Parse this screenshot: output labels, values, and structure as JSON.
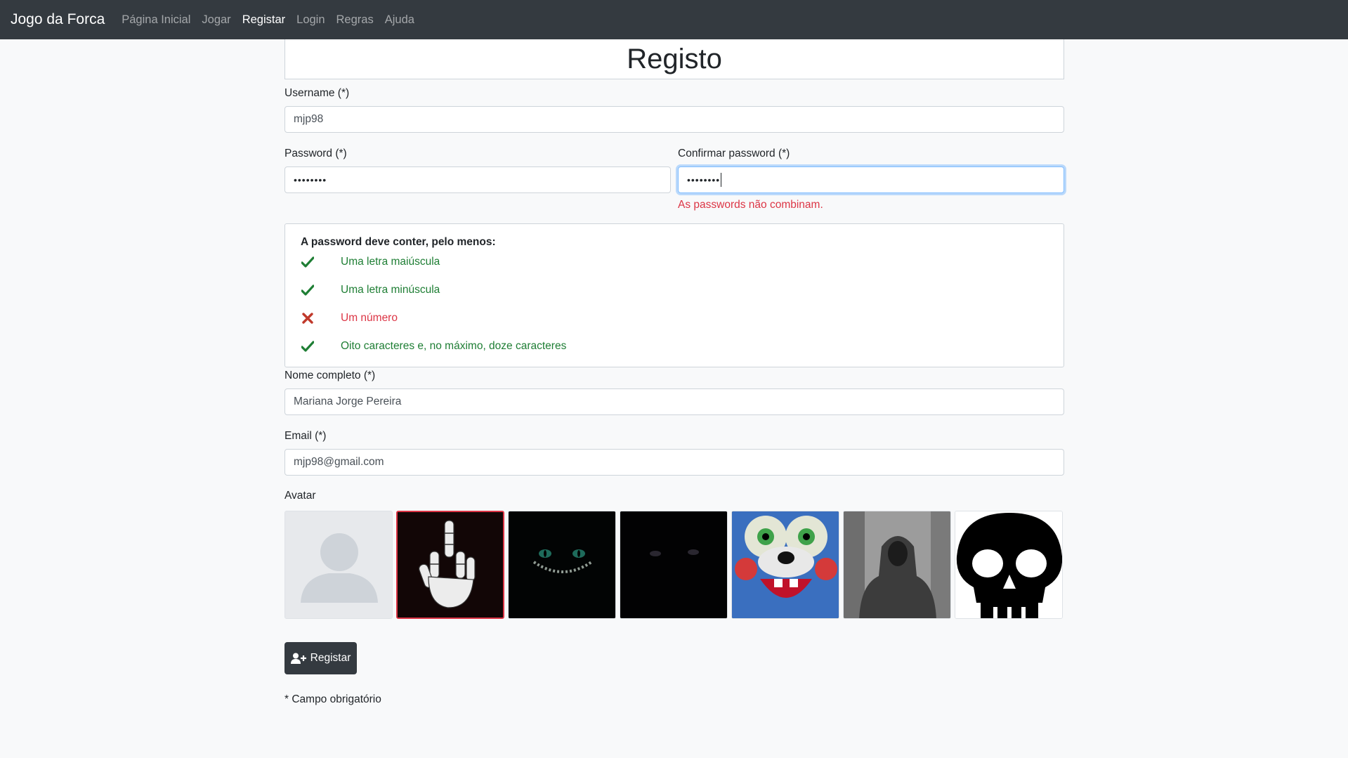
{
  "nav": {
    "brand": "Jogo da Forca",
    "items": [
      {
        "label": "Página Inicial",
        "active": false
      },
      {
        "label": "Jogar",
        "active": false
      },
      {
        "label": "Registar",
        "active": true
      },
      {
        "label": "Login",
        "active": false
      },
      {
        "label": "Regras",
        "active": false
      },
      {
        "label": "Ajuda",
        "active": false
      }
    ]
  },
  "page_title": "Registo",
  "form": {
    "username_label": "Username (*)",
    "username_value": "mjp98",
    "password_label": "Password (*)",
    "password_value": "••••••••",
    "confirm_label": "Confirmar password (*)",
    "confirm_value": "••••••••",
    "confirm_error": "As passwords não combinam.",
    "fullname_label": "Nome completo (*)",
    "fullname_value": "Mariana Jorge Pereira",
    "email_label": "Email (*)",
    "email_value": "mjp98@gmail.com",
    "avatar_label": "Avatar",
    "submit_label": "Registar",
    "footnote": "* Campo obrigatório"
  },
  "password_rules": {
    "title": "A password deve conter, pelo menos:",
    "items": [
      {
        "text": "Uma letra maiúscula",
        "status": "ok"
      },
      {
        "text": "Uma letra minúscula",
        "status": "ok"
      },
      {
        "text": "Um número",
        "status": "fail"
      },
      {
        "text": "Oito caracteres e, no máximo, doze caracteres",
        "status": "ok"
      }
    ]
  },
  "avatars": [
    {
      "name": "default-avatar",
      "selected": false
    },
    {
      "name": "skeleton-hand-avatar",
      "selected": true
    },
    {
      "name": "green-eyes-grin-avatar",
      "selected": false
    },
    {
      "name": "dark-eyes-avatar",
      "selected": false
    },
    {
      "name": "animatronic-avatar",
      "selected": false
    },
    {
      "name": "hooded-figure-avatar",
      "selected": false
    },
    {
      "name": "skull-avatar",
      "selected": false
    }
  ],
  "colors": {
    "navbar": "#343a40",
    "ok": "#1e7e34",
    "error": "#dc3545",
    "focus": "#80bdff"
  }
}
